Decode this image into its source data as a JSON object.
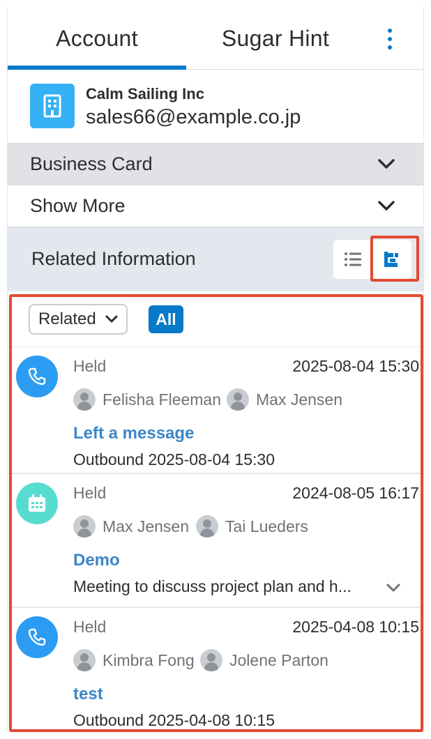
{
  "tabs": [
    {
      "label": "Account"
    },
    {
      "label": "Sugar Hint"
    }
  ],
  "record": {
    "name": "Calm Sailing Inc",
    "email": "sales66@example.co.jp"
  },
  "sections": {
    "business_card": "Business Card",
    "show_more": "Show More"
  },
  "related": {
    "title": "Related Information"
  },
  "filter": {
    "select_label": "Related",
    "all_label": "All"
  },
  "timeline": [
    {
      "type": "call",
      "status": "Held",
      "datetime": "2025-08-04 15:30",
      "people": [
        "Felisha Fleeman",
        "Max Jensen"
      ],
      "subject": "Left a message",
      "description": "Outbound 2025-08-04 15:30"
    },
    {
      "type": "meeting",
      "status": "Held",
      "datetime": "2024-08-05 16:17",
      "people": [
        "Max Jensen",
        "Tai Lueders"
      ],
      "subject": "Demo",
      "description": "Meeting to discuss project plan and h..."
    },
    {
      "type": "call",
      "status": "Held",
      "datetime": "2025-04-08 10:15",
      "people": [
        "Kimbra Fong",
        "Jolene Parton"
      ],
      "subject": "test",
      "description": "Outbound 2025-04-08 10:15"
    }
  ],
  "colors": {
    "accent": "#0679c8",
    "call_icon_bg": "#2b9cf2",
    "meeting_icon_bg": "#57dcd0",
    "highlight": "#e34a33"
  }
}
